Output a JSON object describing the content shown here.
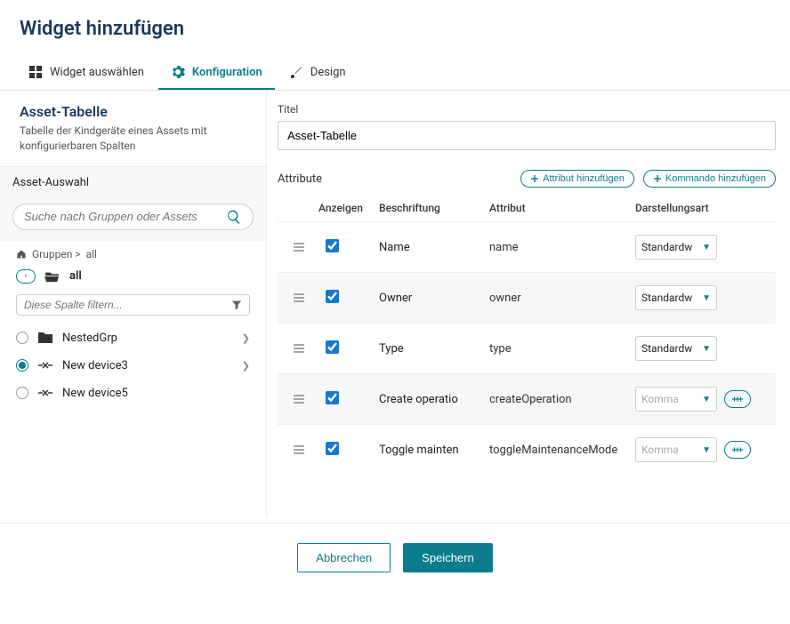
{
  "dialog": {
    "title": "Widget hinzufügen"
  },
  "tabs": {
    "select": "Widget auswählen",
    "config": "Konfiguration",
    "design": "Design",
    "active": "config"
  },
  "left": {
    "title": "Asset-Tabelle",
    "subtitle": "Tabelle der Kindgeräte eines Assets mit konfigurierbaren Spalten",
    "section": "Asset-Auswahl",
    "search_placeholder": "Suche nach Gruppen oder Assets",
    "breadcrumb_prefix": "Gruppen >",
    "breadcrumb_current": "all",
    "all_label": "all",
    "filter_placeholder": "Diese Spalte filtern...",
    "tree": [
      {
        "label": "NestedGrp",
        "icon": "folder",
        "selected": false,
        "expandable": true
      },
      {
        "label": "New device3",
        "icon": "device",
        "selected": true,
        "expandable": true
      },
      {
        "label": "New device5",
        "icon": "device",
        "selected": false,
        "expandable": false
      }
    ]
  },
  "right": {
    "title_label": "Titel",
    "title_value": "Asset-Tabelle",
    "attributes_label": "Attribute",
    "add_attr_btn": "Attribut hinzufügen",
    "add_cmd_btn": "Kommando hinzufügen",
    "headers": {
      "show": "Anzeigen",
      "label": "Beschriftung",
      "attr": "Attribut",
      "mode": "Darstellungsart"
    },
    "rows": [
      {
        "show": true,
        "label": "Name",
        "attr": "name",
        "mode": "Standardwert",
        "disabled": false,
        "edit": false
      },
      {
        "show": true,
        "label": "Owner",
        "attr": "owner",
        "mode": "Standardwert",
        "disabled": false,
        "edit": false
      },
      {
        "show": true,
        "label": "Type",
        "attr": "type",
        "mode": "Standardwert",
        "disabled": false,
        "edit": false
      },
      {
        "show": true,
        "label": "Create operatio",
        "attr": "createOperation",
        "mode": "Kommando",
        "disabled": true,
        "edit": true
      },
      {
        "show": true,
        "label": "Toggle mainten",
        "attr": "toggleMaintenanceMode",
        "mode": "Kommando",
        "disabled": true,
        "edit": true
      }
    ]
  },
  "footer": {
    "cancel": "Abbrechen",
    "save": "Speichern"
  }
}
